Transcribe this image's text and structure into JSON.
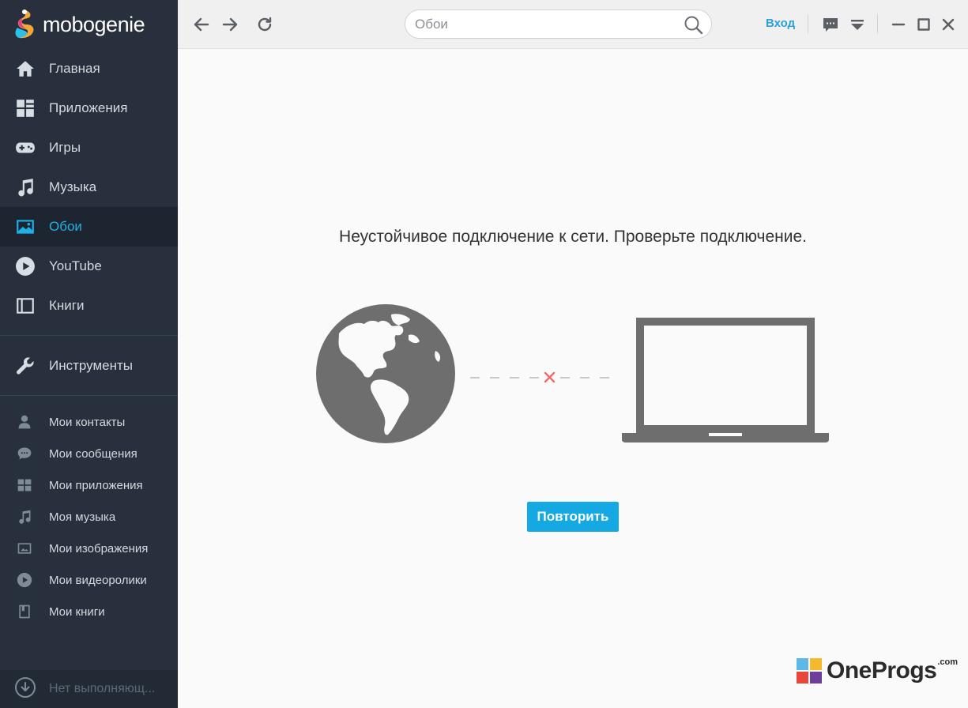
{
  "app": {
    "name": "mobogenie"
  },
  "sidebar": {
    "main_items": [
      {
        "label": "Главная",
        "icon": "home-icon"
      },
      {
        "label": "Приложения",
        "icon": "apps-grid-icon"
      },
      {
        "label": "Игры",
        "icon": "gamepad-icon"
      },
      {
        "label": "Музыка",
        "icon": "music-note-icon"
      },
      {
        "label": "Обои",
        "icon": "wallpaper-icon",
        "active": true
      },
      {
        "label": "YouTube",
        "icon": "play-circle-icon"
      },
      {
        "label": "Книги",
        "icon": "book-icon"
      }
    ],
    "tools": {
      "label": "Инструменты",
      "icon": "wrench-icon"
    },
    "my_items": [
      {
        "label": "Мои контакты",
        "icon": "contact-icon"
      },
      {
        "label": "Мои сообщения",
        "icon": "message-icon"
      },
      {
        "label": "Мои приложения",
        "icon": "apps-grid-icon"
      },
      {
        "label": "Моя музыка",
        "icon": "music-note-icon"
      },
      {
        "label": "Мои изображения",
        "icon": "image-icon"
      },
      {
        "label": "Мои видеоролики",
        "icon": "play-circle-icon"
      },
      {
        "label": "Мои книги",
        "icon": "book-icon"
      }
    ],
    "downloads": {
      "label": "Нет выполняющ...",
      "icon": "download-icon"
    }
  },
  "toolbar": {
    "search_placeholder": "Обои",
    "login_label": "Вход"
  },
  "content": {
    "error_message": "Неустойчивое подключение к сети. Проверьте подключение.",
    "retry_label": "Повторить"
  },
  "watermark": {
    "text": "OneProgs",
    "suffix": ".com"
  },
  "colors": {
    "sidebar_bg": "#27303c",
    "sidebar_active_bg": "#1d2531",
    "accent": "#20b0e8",
    "button_bg": "#14a9e2",
    "error_x": "#f06a6a"
  }
}
